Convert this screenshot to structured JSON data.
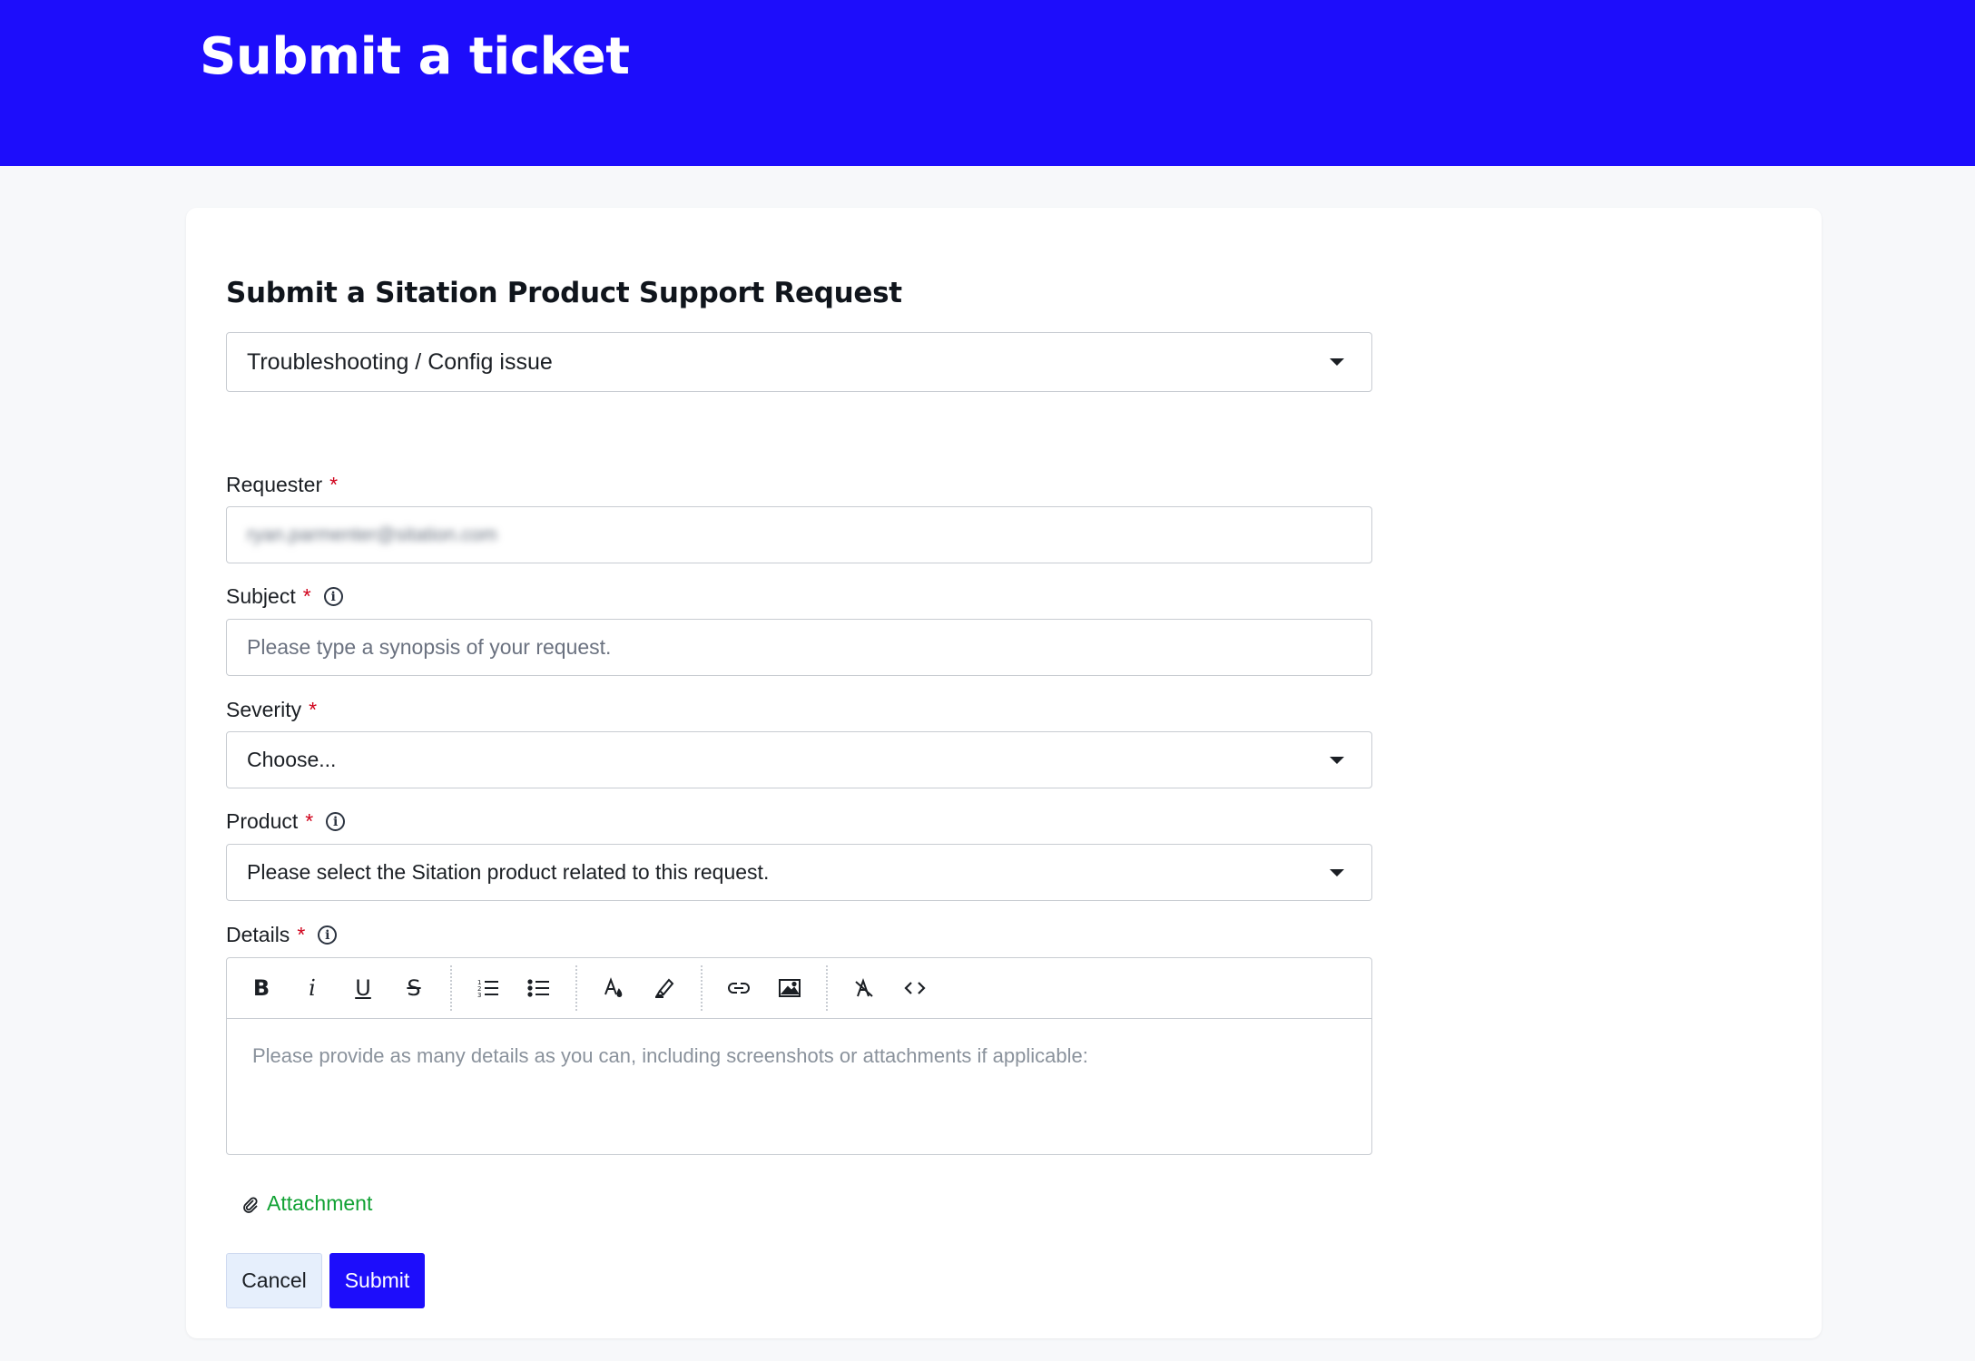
{
  "page": {
    "banner_title": "Submit a ticket",
    "form_title": "Submit a Sitation Product Support Request",
    "accent_color": "#1d0dfb",
    "link_color": "#11a234"
  },
  "ticket_type": {
    "selected": "Troubleshooting / Config issue"
  },
  "requester": {
    "label": "Requester",
    "required_mark": "*",
    "value": "ryan.parmenter@sitation.com"
  },
  "subject": {
    "label": "Subject",
    "required_mark": "*",
    "placeholder": "Please type a synopsis of your request."
  },
  "severity": {
    "label": "Severity",
    "required_mark": "*",
    "selected": "Choose..."
  },
  "product": {
    "label": "Product",
    "required_mark": "*",
    "selected": "Please select the Sitation product related to this request."
  },
  "details": {
    "label": "Details",
    "required_mark": "*",
    "placeholder": "Please provide as many details as you can, including screenshots or attachments if applicable:",
    "toolbar": {
      "bold": "B",
      "italic": "i",
      "underline": "U",
      "strikethrough": "S"
    }
  },
  "attachment": {
    "label": "Attachment"
  },
  "actions": {
    "cancel": "Cancel",
    "submit": "Submit"
  }
}
